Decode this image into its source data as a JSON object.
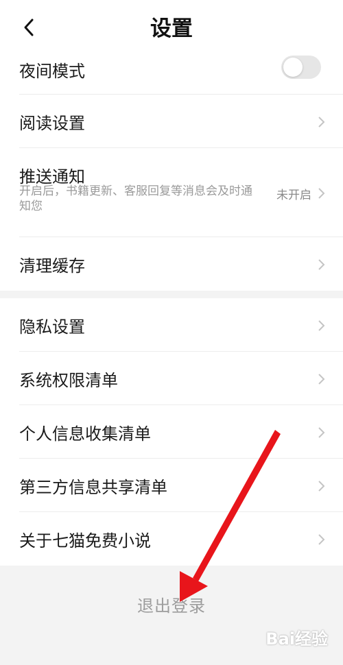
{
  "header": {
    "title": "设置",
    "back_icon": "chevron-left-icon"
  },
  "settings_group_1": [
    {
      "label": "夜间模式",
      "control": "toggle",
      "toggle_on": false
    },
    {
      "label": "阅读设置",
      "control": "chevron"
    },
    {
      "label": "推送通知",
      "control": "chevron",
      "description": "开启后，书籍更新、客服回复等消息会及时通知您",
      "status": "未开启"
    },
    {
      "label": "清理缓存",
      "control": "chevron"
    }
  ],
  "settings_group_2": [
    {
      "label": "隐私设置"
    },
    {
      "label": "系统权限清单"
    },
    {
      "label": "个人信息收集清单"
    },
    {
      "label": "第三方信息共享清单"
    },
    {
      "label": "关于七猫免费小说"
    }
  ],
  "logout_label": "退出登录",
  "annotation": {
    "type": "red-arrow",
    "color": "#e8151b",
    "points_to": "logout-button"
  },
  "watermark": {
    "text": "Bai经验"
  },
  "colors": {
    "background": "#f3f3f3",
    "card": "#ffffff",
    "toggle_off": "#e6e6e6",
    "arrow": "#e8151b"
  }
}
